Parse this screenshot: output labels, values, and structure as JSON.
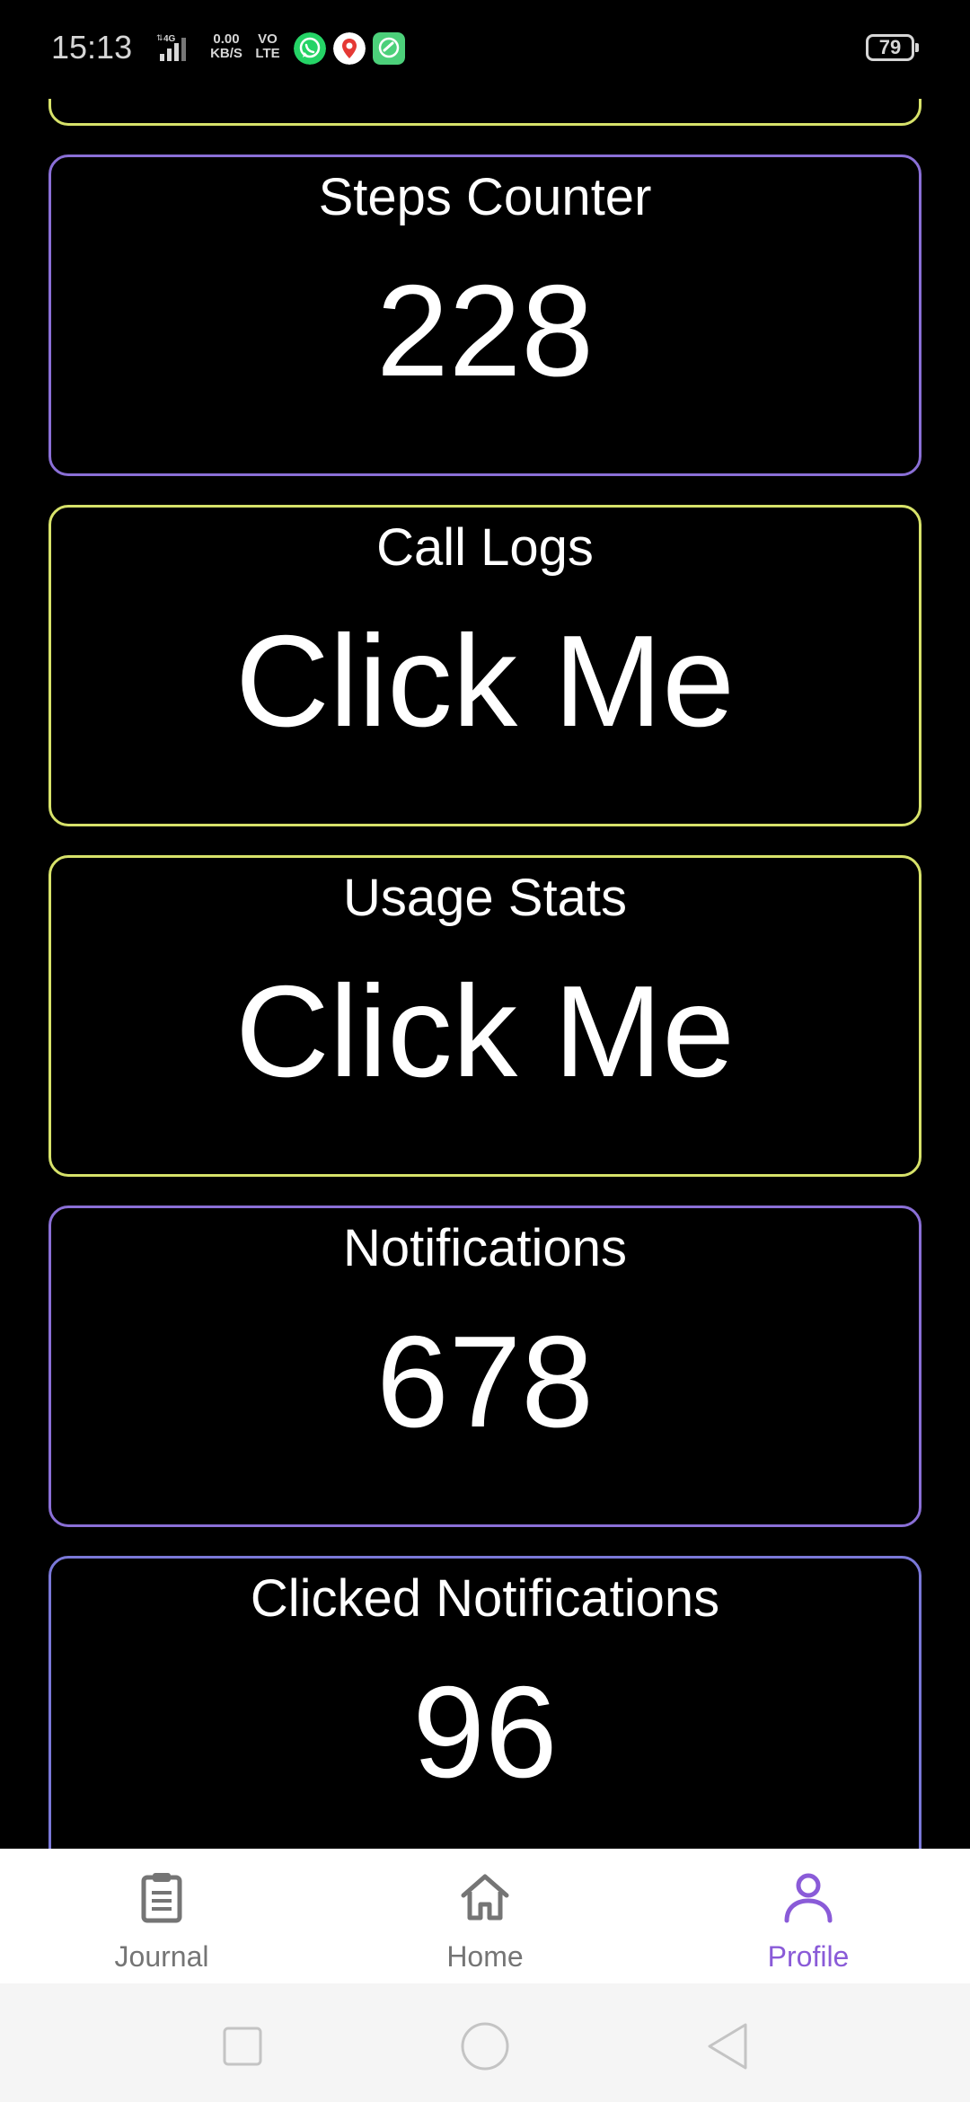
{
  "status_bar": {
    "time": "15:13",
    "network_speed_value": "0.00",
    "network_speed_unit": "KB/S",
    "volte_top": "VO",
    "volte_bottom": "LTE",
    "battery": "79"
  },
  "cards": [
    {
      "title": "",
      "value": "",
      "accent": "#d7e26a"
    },
    {
      "title": "Steps Counter",
      "value": "228",
      "accent": "#8a6fd6"
    },
    {
      "title": "Call Logs",
      "value": "Click Me",
      "accent": "#d7e26a"
    },
    {
      "title": "Usage Stats",
      "value": "Click Me",
      "accent": "#d7e26a"
    },
    {
      "title": "Notifications",
      "value": "678",
      "accent": "#8a6fd6"
    },
    {
      "title": "Clicked Notifications",
      "value": "96",
      "accent": "#7a78d8"
    }
  ],
  "bottom_nav": {
    "items": [
      {
        "label": "Journal",
        "icon": "clipboard-icon",
        "active": false
      },
      {
        "label": "Home",
        "icon": "home-icon",
        "active": false
      },
      {
        "label": "Profile",
        "icon": "profile-icon",
        "active": true
      }
    ],
    "active_color": "#8a5bd8",
    "inactive_color": "#757575"
  },
  "system_nav": {
    "buttons": [
      "recents-icon",
      "home-circle-icon",
      "back-icon"
    ]
  }
}
